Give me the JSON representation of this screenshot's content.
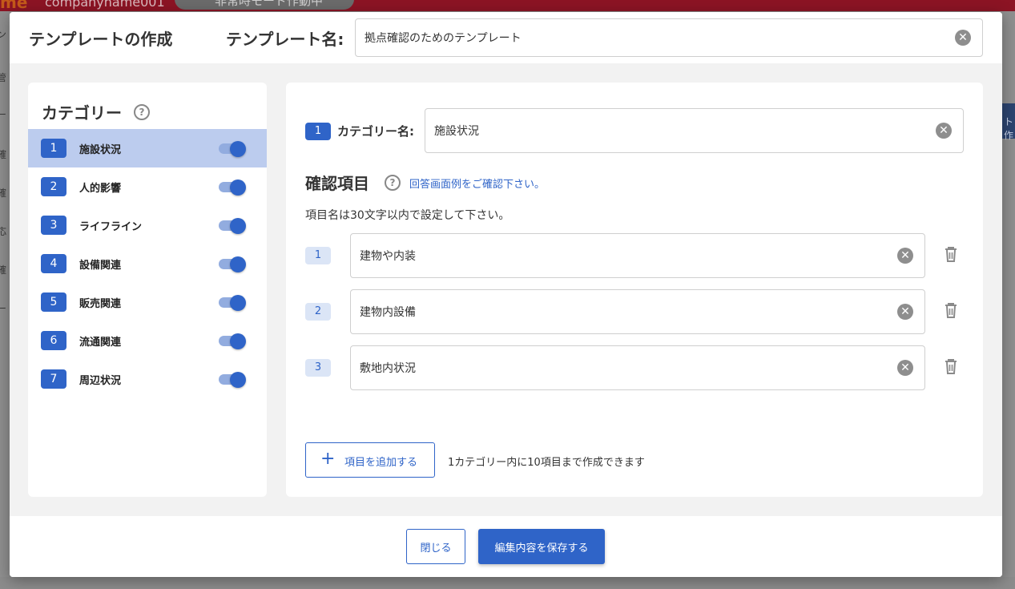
{
  "background": {
    "logo_text": "me",
    "company": "companyname001",
    "mode_pill": "非常時モード作動中",
    "left_fragments": [
      "ン",
      "管",
      "ー",
      "確",
      "確",
      "応",
      "確",
      "ー"
    ],
    "right_button": "ト作"
  },
  "header": {
    "title": "テンプレートの作成",
    "template_name_label": "テンプレート名:",
    "template_name_value": "拠点確認のためのテンプレート"
  },
  "categories": {
    "title": "カテゴリー",
    "help_glyph": "?",
    "items": [
      {
        "num": "1",
        "label": "施設状況",
        "enabled": true,
        "selected": true
      },
      {
        "num": "2",
        "label": "人的影響",
        "enabled": true,
        "selected": false
      },
      {
        "num": "3",
        "label": "ライフライン",
        "enabled": true,
        "selected": false
      },
      {
        "num": "4",
        "label": "設備関連",
        "enabled": true,
        "selected": false
      },
      {
        "num": "5",
        "label": "販売関連",
        "enabled": true,
        "selected": false
      },
      {
        "num": "6",
        "label": "流通関連",
        "enabled": true,
        "selected": false
      },
      {
        "num": "7",
        "label": "周辺状況",
        "enabled": true,
        "selected": false
      }
    ]
  },
  "detail": {
    "category_num": "1",
    "category_name_label": "カテゴリー名:",
    "category_name_value": "施設状況",
    "items_title": "確認項目",
    "help_glyph": "?",
    "items_link": "回答画面例をご確認下さい。",
    "items_note": "項目名は30文字以内で設定して下さい。",
    "items": [
      {
        "num": "1",
        "value": "建物や内装"
      },
      {
        "num": "2",
        "value": "建物内設備"
      },
      {
        "num": "3",
        "value": "敷地内状況"
      }
    ],
    "add_button_icon": "+",
    "add_button_label": "項目を追加する",
    "add_note": "1カテゴリー内に10項目まで作成できます"
  },
  "footer": {
    "close_label": "閉じる",
    "save_label": "編集内容を保存する"
  },
  "icons": {
    "clear": "clear-circle-icon",
    "help": "help-circle-icon",
    "trash": "trash-icon",
    "plus": "plus-icon"
  },
  "colors": {
    "primary": "#2f64c8",
    "selected_row": "#bcccee",
    "topbar": "#8c1424"
  }
}
